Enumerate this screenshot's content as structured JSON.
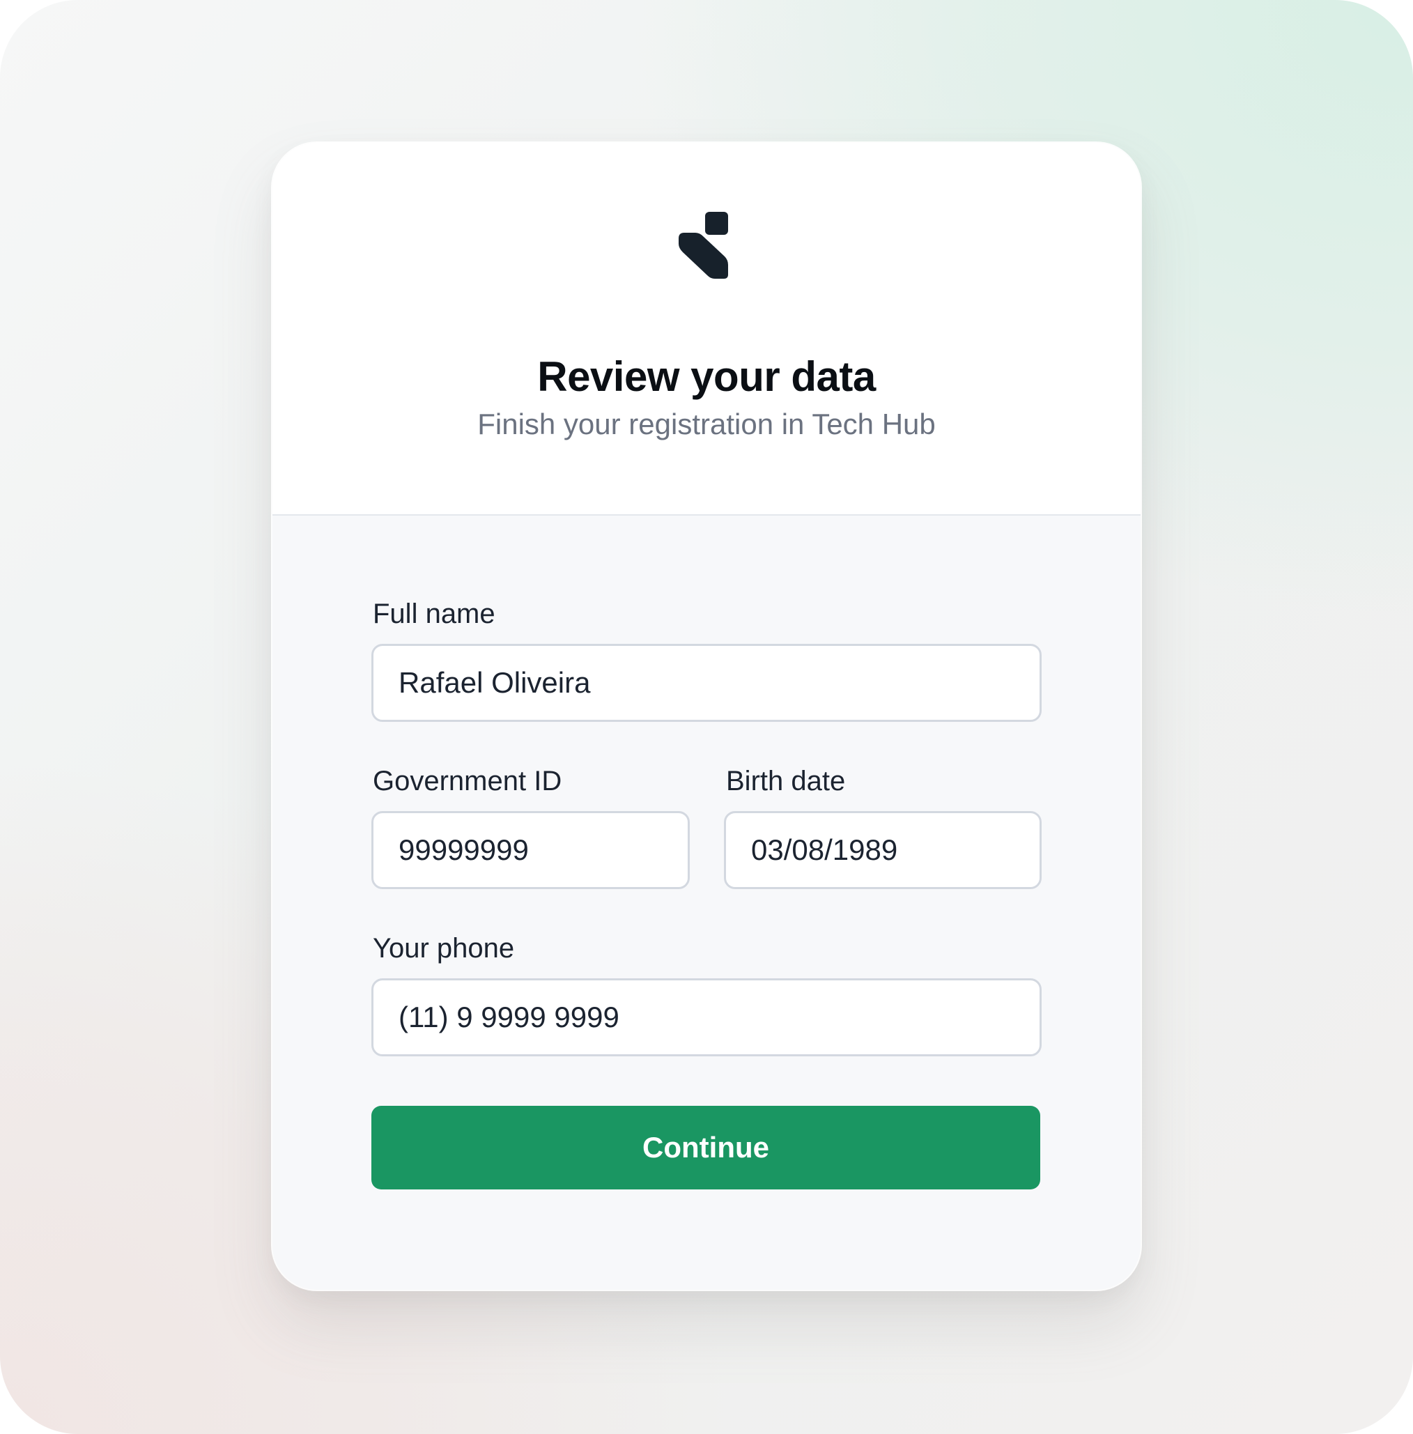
{
  "header": {
    "logo_icon": "brand-logo-icon",
    "title": "Review your data",
    "subtitle": "Finish your registration in Tech Hub"
  },
  "form": {
    "full_name": {
      "label": "Full name",
      "value": "Rafael Oliveira"
    },
    "government_id": {
      "label": "Government ID",
      "value": "99999999"
    },
    "birth_date": {
      "label": "Birth date",
      "value": "03/08/1989"
    },
    "phone": {
      "label": "Your phone",
      "value": "(11) 9 9999 9999"
    },
    "submit_label": "Continue"
  },
  "colors": {
    "accent": "#1a9662",
    "text_primary": "#0b0f14",
    "text_secondary": "#6b7280",
    "input_border": "#d3d8e0"
  }
}
